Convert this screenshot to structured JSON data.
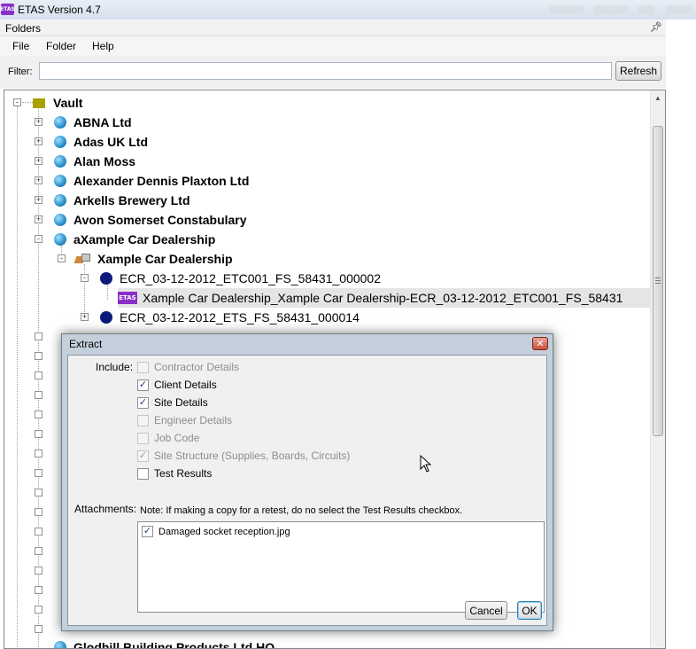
{
  "app": {
    "logo_text": "ETAS",
    "title": "ETAS Version 4.7"
  },
  "panel": {
    "title": "Folders",
    "pin_icon": "pin-icon"
  },
  "menu": {
    "items": [
      "File",
      "Folder",
      "Help"
    ]
  },
  "filter": {
    "label": "Filter:",
    "value": "",
    "refresh_label": "Refresh"
  },
  "tree": {
    "root": {
      "label": "Vault",
      "icon": "vault-icon"
    },
    "items": [
      {
        "label": "ABNA Ltd",
        "icon": "globe-icon",
        "expander": "+"
      },
      {
        "label": "Adas UK Ltd",
        "icon": "globe-icon",
        "expander": "+"
      },
      {
        "label": "Alan Moss",
        "icon": "globe-icon",
        "expander": "+"
      },
      {
        "label": "Alexander Dennis Plaxton Ltd",
        "icon": "globe-icon",
        "expander": "+"
      },
      {
        "label": "Arkells Brewery Ltd",
        "icon": "globe-icon",
        "expander": "+"
      },
      {
        "label": "Avon Somerset Constabulary",
        "icon": "globe-icon",
        "expander": "+"
      },
      {
        "label": "aXample Car Dealership",
        "icon": "globe-icon",
        "expander": "-"
      }
    ],
    "site": {
      "label": "Xample Car Dealership",
      "icon": "dealer-icon",
      "expander": "-"
    },
    "certs": [
      {
        "label": "ECR_03-12-2012_ETC001_FS_58431_000002",
        "expander": "-"
      },
      {
        "label": "ECR_03-12-2012_ETS_FS_58431_000014",
        "expander": "+"
      }
    ],
    "doc": {
      "badge": "ETAS",
      "label": "Xample Car Dealership_Xample Car Dealership-ECR_03-12-2012_ETC001_FS_58431"
    },
    "bottom_item": "Glodhill Building Products Ltd HQ",
    "scroll_up": "▲"
  },
  "dialog": {
    "title": "Extract",
    "close": "✕",
    "include_label": "Include:",
    "options": [
      {
        "label": "Contractor Details",
        "checked": false,
        "enabled": false
      },
      {
        "label": "Client Details",
        "checked": true,
        "enabled": true
      },
      {
        "label": "Site Details",
        "checked": true,
        "enabled": true
      },
      {
        "label": "Engineer Details",
        "checked": false,
        "enabled": false
      },
      {
        "label": "Job Code",
        "checked": false,
        "enabled": false
      },
      {
        "label": "Site Structure (Supplies, Boards, Circuits)",
        "checked": true,
        "enabled": false
      },
      {
        "label": "Test Results",
        "checked": false,
        "enabled": true
      }
    ],
    "note": "Note: If making a copy for a retest, do no select the Test Results checkbox.",
    "attachments_label": "Attachments:",
    "attachments": [
      {
        "label": "Damaged socket reception.jpg",
        "checked": true
      }
    ],
    "cancel_label": "Cancel",
    "ok_label": "OK"
  }
}
